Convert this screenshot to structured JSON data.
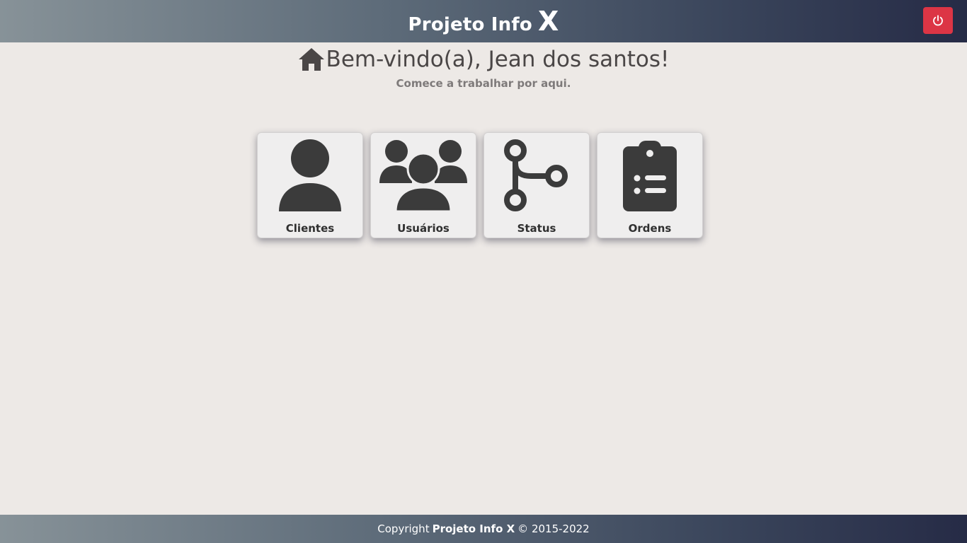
{
  "header": {
    "brand_text": "Projeto Info",
    "brand_x": "X",
    "logout_icon": "power-icon",
    "logout_color": "#dc3545"
  },
  "welcome": {
    "icon": "home-icon",
    "title": "Bem-vindo(a), Jean dos santos!",
    "subtitle": "Comece a trabalhar por aqui."
  },
  "tiles": [
    {
      "label": "Clientes",
      "icon": "user-icon"
    },
    {
      "label": "Usuários",
      "icon": "users-group-icon"
    },
    {
      "label": "Status",
      "icon": "git-branch-icon"
    },
    {
      "label": "Ordens",
      "icon": "clipboard-list-icon"
    }
  ],
  "footer": {
    "prefix": "Copyright",
    "brand": "Projeto Info X",
    "suffix": "© 2015-2022"
  }
}
